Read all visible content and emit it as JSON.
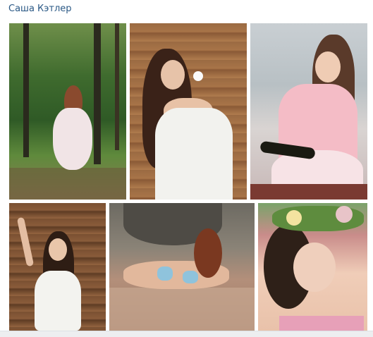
{
  "album": {
    "title": "Саша Кэтлер"
  },
  "photos": [
    {
      "id": "p1",
      "subject": "forest"
    },
    {
      "id": "p2",
      "subject": "wooden-wall-rose"
    },
    {
      "id": "p3",
      "subject": "pink-top-champagne"
    },
    {
      "id": "p4",
      "subject": "wooden-wall-arm-up"
    },
    {
      "id": "p5",
      "subject": "beach"
    },
    {
      "id": "p6",
      "subject": "flower-crown"
    }
  ],
  "colors": {
    "link": "#2a5885",
    "background": "#ffffff"
  }
}
